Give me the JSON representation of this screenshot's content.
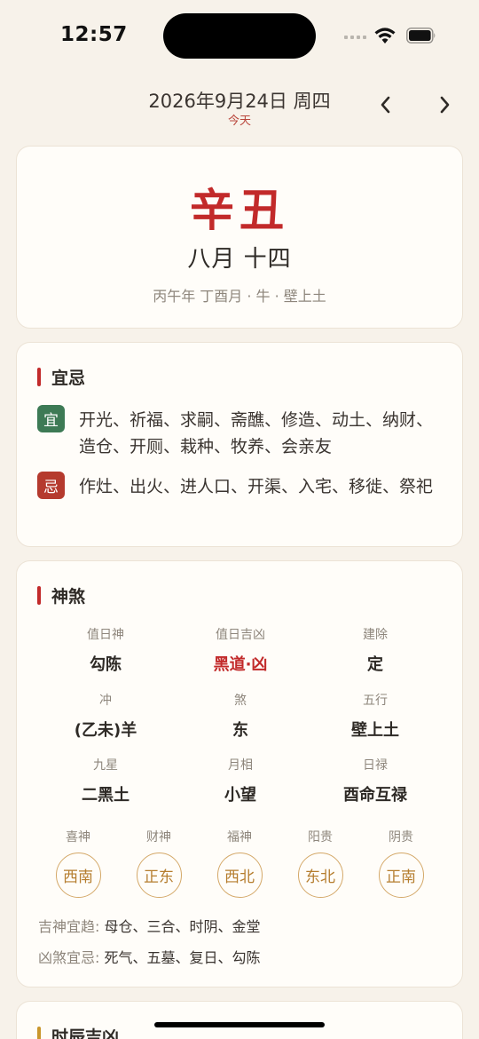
{
  "status": {
    "time": "12:57"
  },
  "header": {
    "date": "2026年9月24日 周四",
    "today": "今天",
    "prev_icon": "chevron-left",
    "next_icon": "chevron-right"
  },
  "hero": {
    "ganzhi": "辛丑",
    "lunar": "八月 十四",
    "pillars": "丙午年 丁酉月 · 牛 · 壁上土"
  },
  "yiji": {
    "title": "宜忌",
    "yi_badge": "宜",
    "yi_text": "开光、祈福、求嗣、斋醮、修造、动土、纳财、造仓、开厕、栽种、牧养、会亲友",
    "ji_badge": "忌",
    "ji_text": "作灶、出火、进人口、开渠、入宅、移徙、祭祀"
  },
  "shensha": {
    "title": "神煞",
    "grid": [
      {
        "label": "值日神",
        "value": "勾陈"
      },
      {
        "label": "值日吉凶",
        "value": "黑道·凶"
      },
      {
        "label": "建除",
        "value": "定"
      },
      {
        "label": "冲",
        "value": "(乙未)羊"
      },
      {
        "label": "煞",
        "value": "东"
      },
      {
        "label": "五行",
        "value": "壁上土"
      },
      {
        "label": "九星",
        "value": "二黑土"
      },
      {
        "label": "月相",
        "value": "小望"
      },
      {
        "label": "日禄",
        "value": "酉命互禄"
      }
    ],
    "directions": [
      {
        "label": "喜神",
        "value": "西南"
      },
      {
        "label": "财神",
        "value": "正东"
      },
      {
        "label": "福神",
        "value": "西北"
      },
      {
        "label": "阳贵",
        "value": "东北"
      },
      {
        "label": "阴贵",
        "value": "正南"
      }
    ],
    "ji_shen_label": "吉神宜趋:",
    "ji_shen": "母仓、三合、时阴、金堂",
    "xiong_sha_label": "凶煞宜忌:",
    "xiong_sha": "死气、五墓、复日、勾陈"
  },
  "shichen": {
    "title": "时辰吉凶"
  },
  "colors": {
    "accent_red": "#c22a2a",
    "yi_green": "#3d7a55",
    "ji_red": "#b53a2e",
    "gold": "#c9962c",
    "background": "#f7f2ea"
  }
}
